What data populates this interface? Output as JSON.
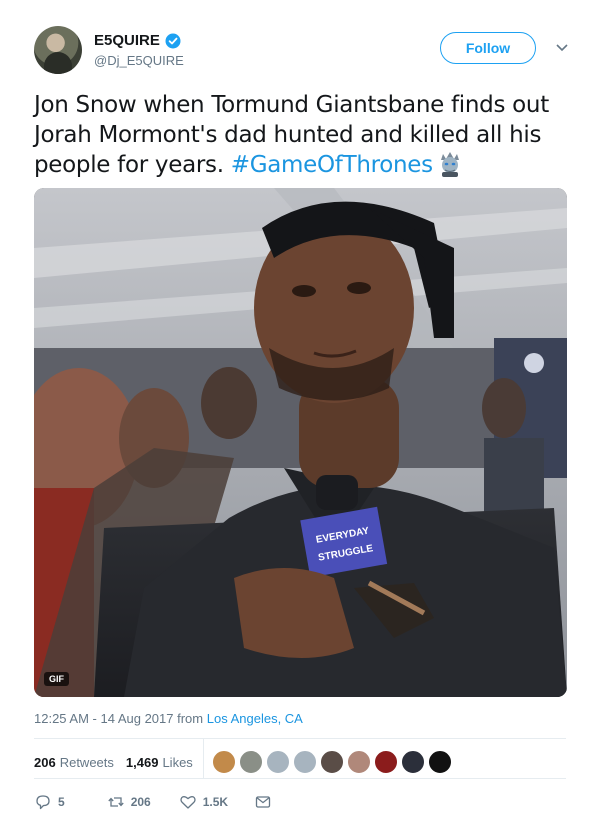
{
  "author": {
    "display_name": "E5QUIRE",
    "handle": "@Dj_E5QUIRE",
    "verified": true
  },
  "follow_label": "Follow",
  "tweet": {
    "text": "Jon Snow when Tormund Giantsbane finds out Jorah Mormont's dad hunted and killed all his people for years. ",
    "hashtag": "#GameOfThrones"
  },
  "media": {
    "badge": "GIF",
    "mic_flag_line1": "EVERYDAY",
    "mic_flag_line2": "STRUGGLE"
  },
  "meta": {
    "time": "12:25 AM - 14 Aug 2017 from ",
    "location": "Los Angeles, CA"
  },
  "stats": {
    "retweets_count": "206",
    "retweets_label": "Retweets",
    "likes_count": "1,469",
    "likes_label": "Likes"
  },
  "likers": [
    "#c28a4a",
    "#8a8f87",
    "#a7b4bf",
    "#a7b4bf",
    "#5a4d47",
    "#b0887a",
    "#8b1c1c",
    "#2b2f3a",
    "#111111"
  ],
  "actions": {
    "reply_count": "5",
    "retweet_count": "206",
    "like_count": "1.5K"
  },
  "colors": {
    "accent": "#1da1f2",
    "link": "#1b95e0",
    "muted": "#657786"
  }
}
